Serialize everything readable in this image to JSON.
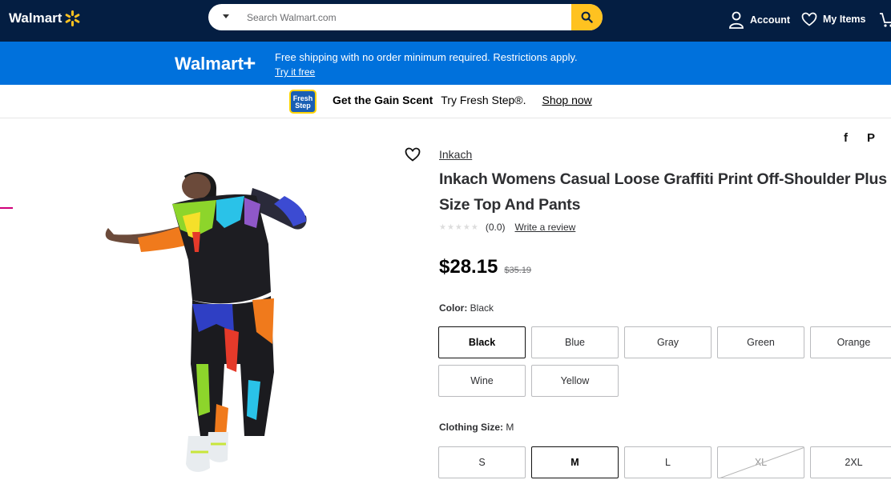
{
  "header": {
    "logo": "Walmart",
    "search_placeholder": "Search Walmart.com",
    "account": "Account",
    "my_items": "My Items"
  },
  "promo": {
    "logo": "Walmart",
    "logo_plus": "+",
    "text": "Free shipping with no order minimum required. Restrictions apply.",
    "link": "Try it free"
  },
  "ad": {
    "badge": "Fresh Step",
    "headline": "Get the Gain Scent",
    "sub": "Try Fresh Step®.",
    "link": "Shop now"
  },
  "product": {
    "brand": "Inkach",
    "title": "Inkach Womens Casual Loose Graffiti Print Off-Shoulder Plus Size Top And Pants",
    "stars": "★★★★★",
    "rating": "(0.0)",
    "review_link": "Write a review",
    "price": "$28.15",
    "was_price": "$35.19",
    "color_label": "Color:",
    "color_value": "Black",
    "colors": [
      "Black",
      "Blue",
      "Gray",
      "Green",
      "Orange",
      "Wine",
      "Yellow"
    ],
    "size_label": "Clothing Size:",
    "size_value": "M",
    "sizes": [
      "S",
      "M",
      "L",
      "XL",
      "2XL"
    ],
    "share_facebook": "f",
    "share_pinterest": "P"
  },
  "colors": {
    "navy": "#041e42",
    "blue": "#0071dc",
    "yellow": "#ffc220"
  }
}
